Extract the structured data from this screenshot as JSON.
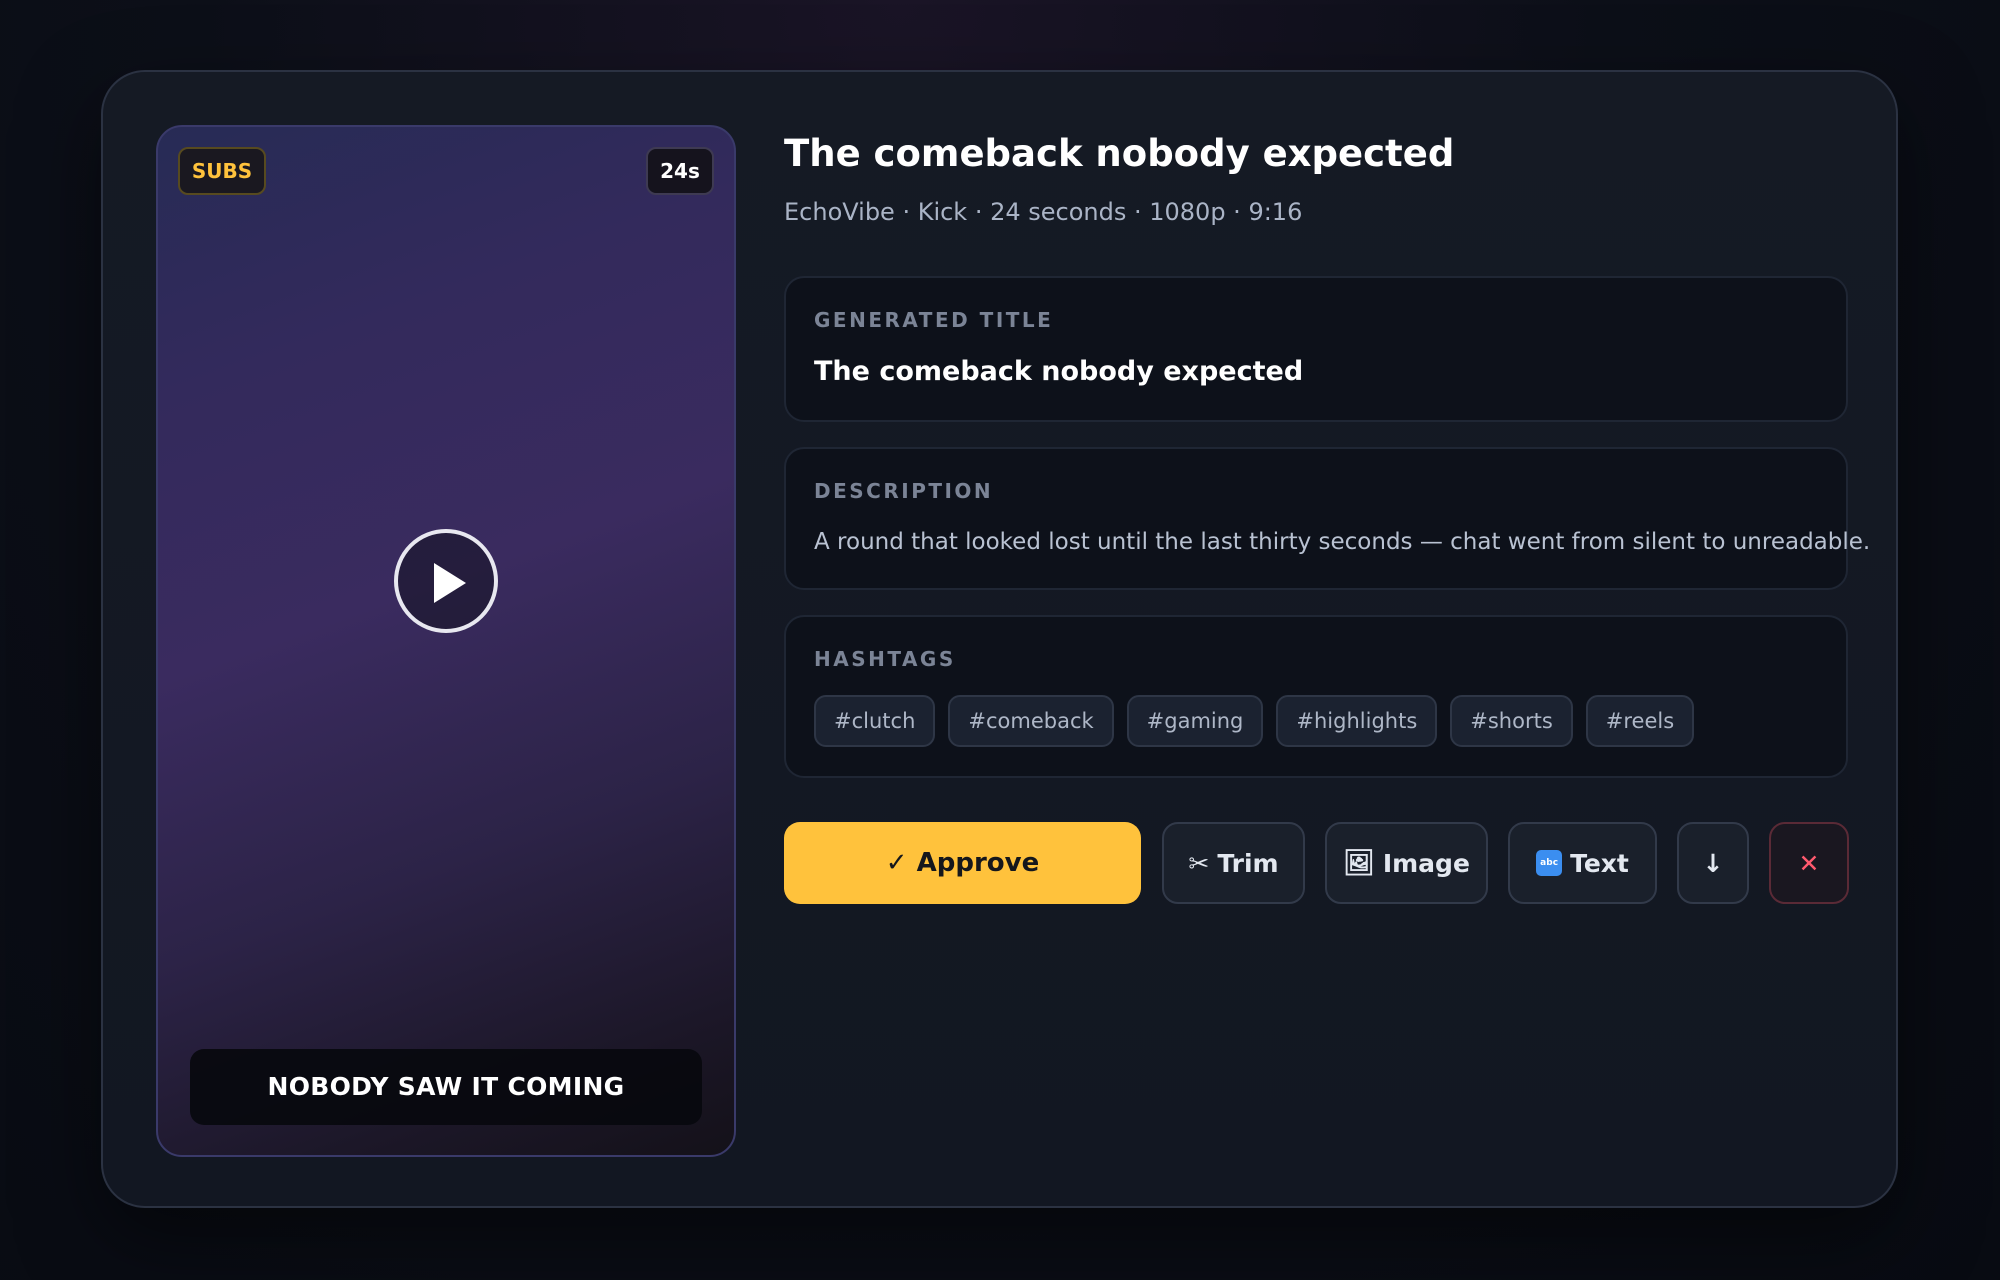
{
  "preview": {
    "subs_badge": "SUBS",
    "duration_badge": "24s",
    "caption": "NOBODY SAW IT COMING"
  },
  "header": {
    "title": "The comeback nobody expected",
    "meta": "EchoVibe · Kick · 24 seconds · 1080p · 9:16"
  },
  "generated_title": {
    "label": "GENERATED TITLE",
    "value": "The comeback nobody expected"
  },
  "description": {
    "label": "DESCRIPTION",
    "value": "A round that looked lost until the last thirty seconds — chat went from silent to unreadable."
  },
  "hashtags": {
    "label": "HASHTAGS",
    "items": [
      "#clutch",
      "#comeback",
      "#gaming",
      "#highlights",
      "#shorts",
      "#reels"
    ]
  },
  "actions": {
    "approve_label": "✓ Approve",
    "trim_label": "Trim",
    "trim_icon": "✂",
    "image_label": "Image",
    "image_icon": "🖼",
    "text_label": "Text",
    "text_icon": "🔤",
    "download_icon": "↓",
    "reject_icon": "✕"
  },
  "colors": {
    "accent": "#ffc23c",
    "danger": "#ff5a6e",
    "card_bg": "#151a24",
    "panel_bg": "#0d111a"
  }
}
